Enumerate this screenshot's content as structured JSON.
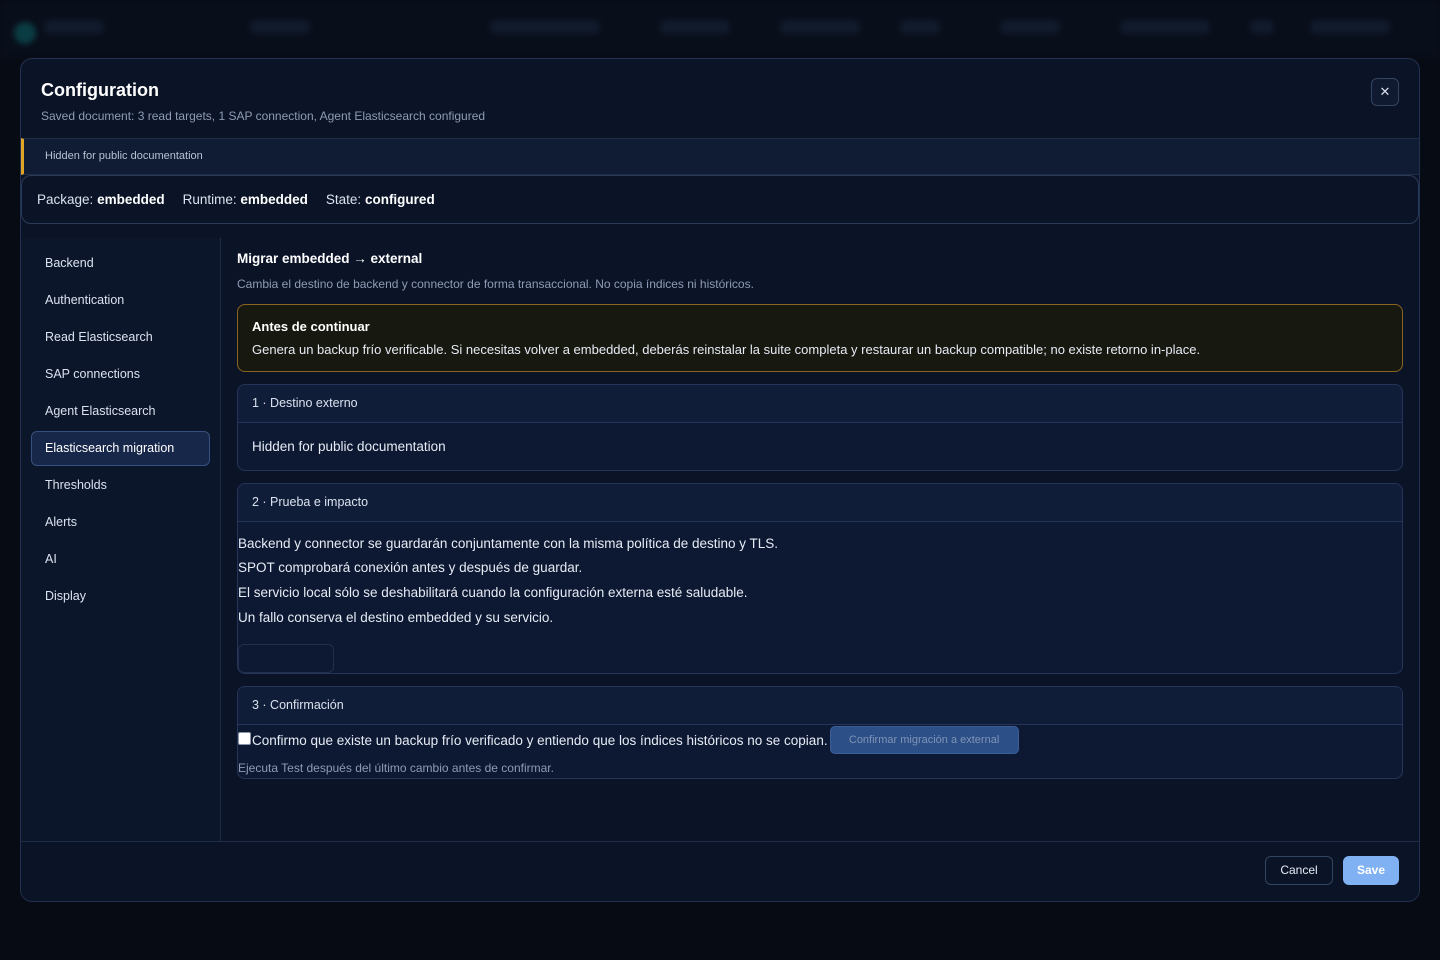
{
  "modal": {
    "title": "Configuration",
    "subtitle": "Saved document: 3 read targets, 1 SAP connection, Agent Elasticsearch configured",
    "close_icon": "close-icon",
    "notice": "Hidden for public documentation",
    "accent_color": "#e0a526"
  },
  "status": {
    "package_label": "Package:",
    "package_value": "embedded",
    "runtime_label": "Runtime:",
    "runtime_value": "embedded",
    "state_label": "State:",
    "state_value": "configured"
  },
  "sidebar": {
    "items": [
      {
        "label": "Backend"
      },
      {
        "label": "Authentication"
      },
      {
        "label": "Read Elasticsearch"
      },
      {
        "label": "SAP connections"
      },
      {
        "label": "Agent Elasticsearch"
      },
      {
        "label": "Elasticsearch migration",
        "active": true
      },
      {
        "label": "Thresholds"
      },
      {
        "label": "Alerts"
      },
      {
        "label": "AI"
      },
      {
        "label": "Display"
      }
    ]
  },
  "section": {
    "title": "Migrar embedded → external",
    "description": "Cambia el destino de backend y connector de forma transaccional. No copia índices ni históricos."
  },
  "warning": {
    "title": "Antes de continuar",
    "text": "Genera un backup frío verificable. Si necesitas volver a embedded, deberás reinstalar la suite completa y restaurar un backup compatible; no existe retorno in-place."
  },
  "step1": {
    "title": "1 · Destino externo",
    "body": "Hidden for public documentation"
  },
  "step2": {
    "title": "2 · Prueba e impacto",
    "lines": [
      "Backend y connector se guardarán conjuntamente con la misma política de destino y TLS.",
      "SPOT comprobará conexión antes y después de guardar.",
      "El servicio local sólo se deshabilitará cuando la configuración externa esté saludable.",
      "Un fallo conserva el destino embedded y su servicio."
    ]
  },
  "step3": {
    "title": "3 · Confirmación",
    "checkbox_label": "Confirmo que existe un backup frío verificado y entiendo que los índices históricos no se copian.",
    "confirm_button": "Confirmar migración a external",
    "hint": "Ejecuta Test después del último cambio antes de confirmar."
  },
  "footer": {
    "cancel": "Cancel",
    "save": "Save"
  }
}
